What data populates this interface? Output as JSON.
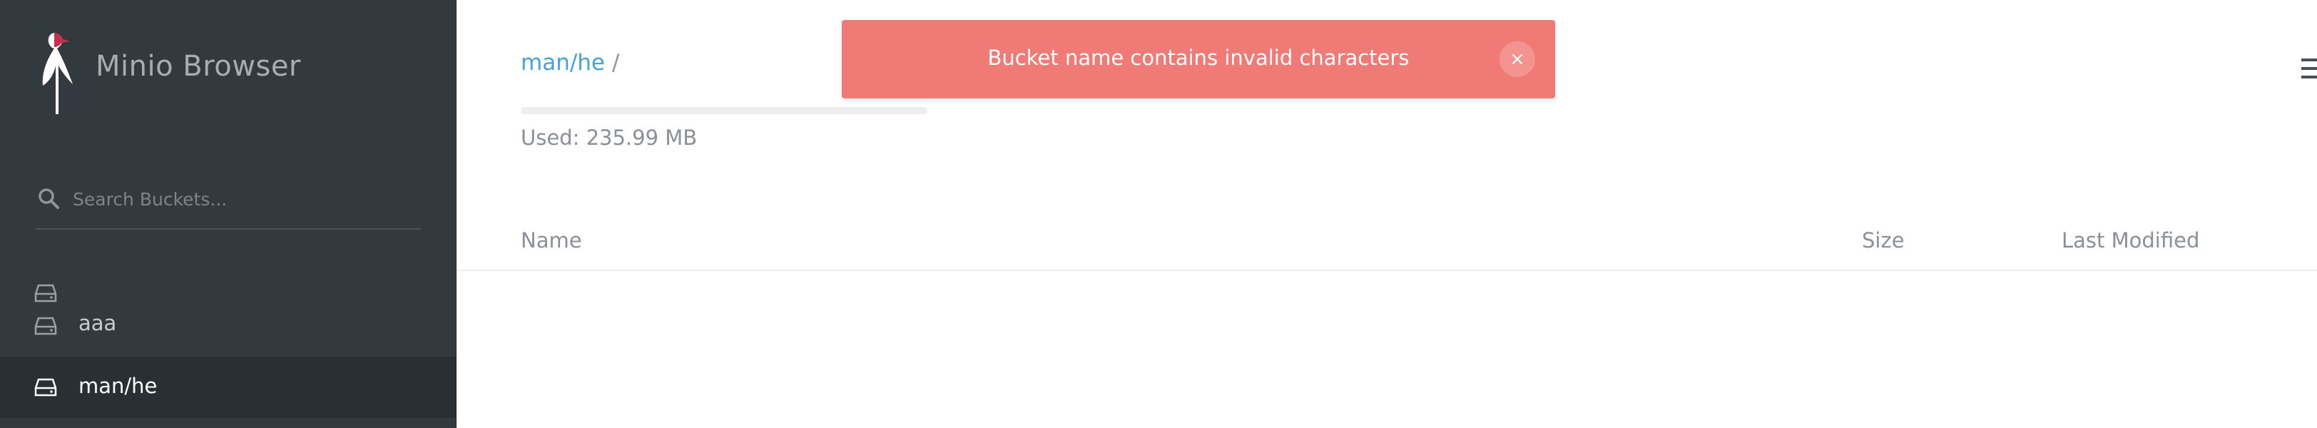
{
  "sidebar": {
    "brand": "Minio Browser",
    "search": {
      "placeholder": "Search Buckets...",
      "value": ""
    },
    "buckets": [
      {
        "label": ""
      },
      {
        "label": "aaa"
      },
      {
        "label": "man/he",
        "active": true
      }
    ]
  },
  "main": {
    "breadcrumb": {
      "bucket": "man/he",
      "separator": "/"
    },
    "usage": {
      "text": "Used: 235.99 MB"
    },
    "table": {
      "columns": [
        "Name",
        "Size",
        "Last Modified"
      ],
      "rows": []
    }
  },
  "alert": {
    "message": "Bucket name contains invalid characters",
    "close_label": "×",
    "color": "#f07a76"
  },
  "icons": {
    "logo": "minio-crane-logo",
    "search": "search-icon",
    "bucket": "drive-icon",
    "menu": "hamburger-menu-icon"
  }
}
